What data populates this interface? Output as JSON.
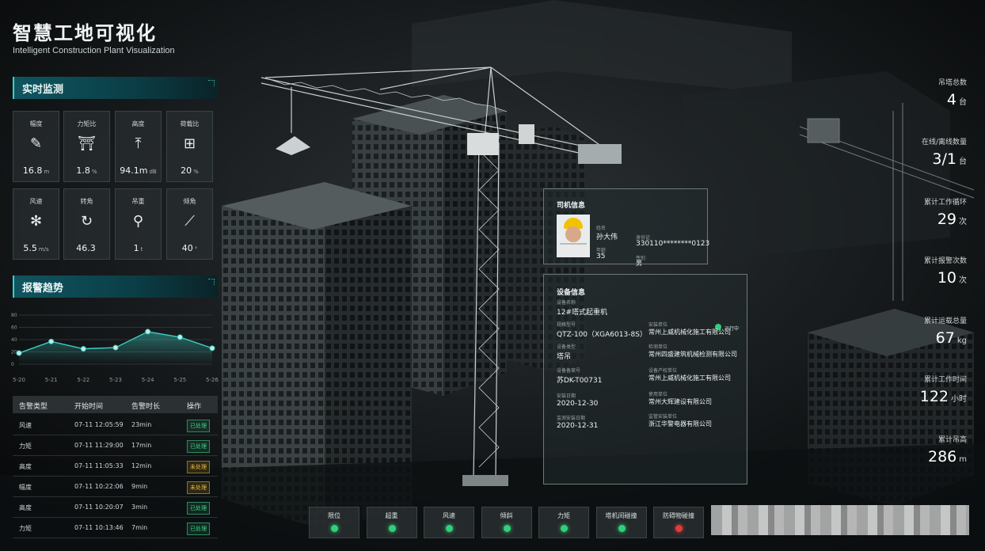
{
  "header": {
    "title": "智慧工地可视化",
    "subtitle": "Intelligent Construction Plant Visualization"
  },
  "monitor": {
    "title": "实时监测",
    "cards": [
      {
        "label": "幅度",
        "icon": "ruler-icon",
        "value": "16.8",
        "unit": "m"
      },
      {
        "label": "力矩比",
        "icon": "crane-frame-icon",
        "value": "1.8",
        "unit": "%"
      },
      {
        "label": "高度",
        "icon": "height-icon",
        "value": "94.1m",
        "unit": "dB"
      },
      {
        "label": "荷载比",
        "icon": "load-icon",
        "value": "20",
        "unit": "%"
      },
      {
        "label": "风速",
        "icon": "fan-icon",
        "value": "5.5",
        "unit": "m/s"
      },
      {
        "label": "转角",
        "icon": "rotate-icon",
        "value": "46.3",
        "unit": ""
      },
      {
        "label": "吊重",
        "icon": "weight-icon",
        "value": "1",
        "unit": "t"
      },
      {
        "label": "倾角",
        "icon": "tilt-icon",
        "value": "40",
        "unit": "°"
      }
    ]
  },
  "alarm_trend": {
    "title": "报警趋势",
    "chart_data": {
      "type": "area",
      "categories": [
        "5-20",
        "5-21",
        "5-22",
        "5-23",
        "5-24",
        "5-25",
        "5-26"
      ],
      "values": [
        18,
        37,
        25,
        27,
        53,
        44,
        26
      ],
      "ylim": [
        0,
        80
      ],
      "yticks": [
        "0",
        "20",
        "40",
        "60",
        "80"
      ],
      "color": "#3ad0c4"
    }
  },
  "alarm_table": {
    "headers": [
      "告警类型",
      "开始时间",
      "告警时长",
      "操作"
    ],
    "rows": [
      {
        "type": "风速",
        "time": "07-11 12:05:59",
        "dur": "23min",
        "status": "已处理",
        "kind": "done"
      },
      {
        "type": "力矩",
        "time": "07-11 11:29:00",
        "dur": "17min",
        "status": "已处理",
        "kind": "done"
      },
      {
        "type": "高度",
        "time": "07-11 11:05:33",
        "dur": "12min",
        "status": "未处理",
        "kind": "pending"
      },
      {
        "type": "幅度",
        "time": "07-11 10:22:06",
        "dur": "9min",
        "status": "未处理",
        "kind": "pending"
      },
      {
        "type": "高度",
        "time": "07-11 10:20:07",
        "dur": "3min",
        "status": "已处理",
        "kind": "done"
      },
      {
        "type": "力矩",
        "time": "07-11 10:13:46",
        "dur": "7min",
        "status": "已处理",
        "kind": "done"
      }
    ]
  },
  "stats": [
    {
      "label": "吊塔总数",
      "value": "4",
      "unit": "台"
    },
    {
      "label": "在线/离线数量",
      "value": "3/1",
      "unit": "台"
    },
    {
      "label": "累计工作循环",
      "value": "29",
      "unit": "次"
    },
    {
      "label": "累计报警次数",
      "value": "10",
      "unit": "次"
    },
    {
      "label": "累计运载总量",
      "value": "67",
      "unit": "kg"
    },
    {
      "label": "累计工作时间",
      "value": "122",
      "unit": "小时"
    },
    {
      "label": "累计吊高",
      "value": "286",
      "unit": "m"
    }
  ],
  "driver": {
    "title": "司机信息",
    "name_label": "姓名",
    "name": "孙大伟",
    "age_label": "年龄",
    "age": "35",
    "id_label": "身份证",
    "id": "330110********0123",
    "gender_label": "性别",
    "gender": "男"
  },
  "device": {
    "title": "设备信息",
    "status": "运行中",
    "left": [
      {
        "label": "设备名称",
        "value": "12#塔式起重机"
      },
      {
        "label": "规格型号",
        "value": "QTZ-100（XGA6013-8S）"
      },
      {
        "label": "设备类型",
        "value": "塔吊"
      },
      {
        "label": "设备备案号",
        "value": "苏DK-T00731"
      },
      {
        "label": "安装日期",
        "value": "2020-12-30"
      },
      {
        "label": "监测安装日期",
        "value": "2020-12-31"
      }
    ],
    "right": [
      {
        "label": "安装单位",
        "value": "常州上威机械化施工有限公司"
      },
      {
        "label": "检测单位",
        "value": "常州四盛建筑机械检测有限公司"
      },
      {
        "label": "设备产权单位",
        "value": "常州上威机械化施工有限公司"
      },
      {
        "label": "使用单位",
        "value": "常州大辉建设有限公司"
      },
      {
        "label": "监管安装单位",
        "value": "浙江华警电器有限公司"
      }
    ]
  },
  "status_bar": [
    {
      "label": "限位",
      "color": "#2fd07a"
    },
    {
      "label": "超重",
      "color": "#2fd07a"
    },
    {
      "label": "风速",
      "color": "#2fd07a"
    },
    {
      "label": "倾斜",
      "color": "#2fd07a"
    },
    {
      "label": "力矩",
      "color": "#2fd07a"
    },
    {
      "label": "塔机间碰撞",
      "color": "#2fd07a"
    },
    {
      "label": "防碍物碰撞",
      "color": "#e23a3a"
    }
  ]
}
